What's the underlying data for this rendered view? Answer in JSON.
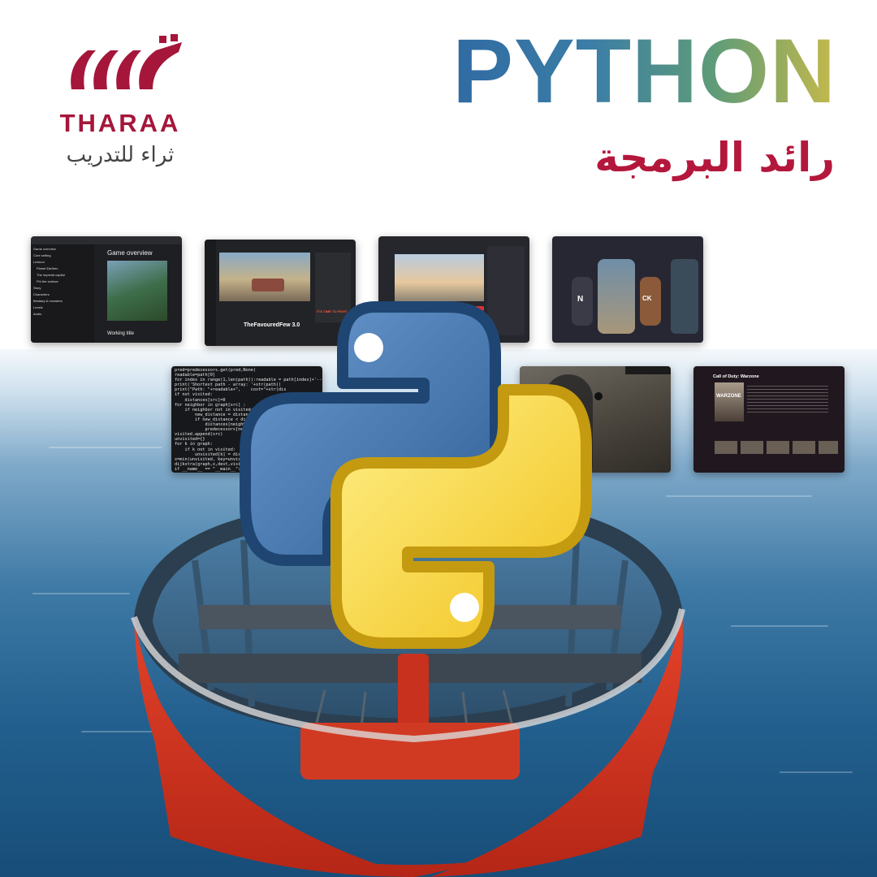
{
  "brand": {
    "name_en": "THARAA",
    "name_ar": "ثراء للتدريب"
  },
  "headline": {
    "title": "PYTHON",
    "subtitle": "رائد البرمجة"
  },
  "screens": {
    "docs": {
      "heading": "Game overview",
      "subheading": "Working title",
      "sidebar": [
        "Game overview",
        "Core setting",
        "Lexicon",
        "Planet Earthen",
        "The imperial capital",
        "Phi the surface",
        "Story",
        "Characters",
        "Bestiary & monsters",
        "Levels",
        "Audio"
      ]
    },
    "video": {
      "title": "TheFavouredFew 3.0",
      "banner": "IT'S TIME TO FIGHT"
    },
    "game": {
      "title": "Call of Duty: Warzone",
      "cover": "WARZONE"
    },
    "nav_letters": [
      "N",
      "CK"
    ]
  },
  "code_lines": [
    "pred=predecessors.get(pred,None)",
    "readable=path[0]",
    "for index in range(1,len(path)):readable = path[index]+'---",
    "print('Shortest path - array: '+str(path))",
    "print(\"Path: \"+readable+\",    cost=\"+str(dis",
    "if not visited:",
    "    distances[src]=0",
    "for neighbor in graph[src] :",
    "    if neighbor not in visited:",
    "        new_distance = distances[",
    "        if new_distance < dist",
    "            distances[neighbor",
    "            predecessors[neigh",
    "visited.append(src)",
    "unvisited={}",
    "for k in graph:",
    "    if k not in visited:",
    "        unvisited[k] = dist",
    "x=min(unvisited, key=unvisi",
    "dijkstra(graph,x,dest,visit",
    "if __name__ == \"__main__\":"
  ],
  "colors": {
    "brand_red": "#a5163a",
    "title_blue": "#2e67a2",
    "title_gold": "#c6b94a",
    "boat_red": "#d8341f"
  }
}
